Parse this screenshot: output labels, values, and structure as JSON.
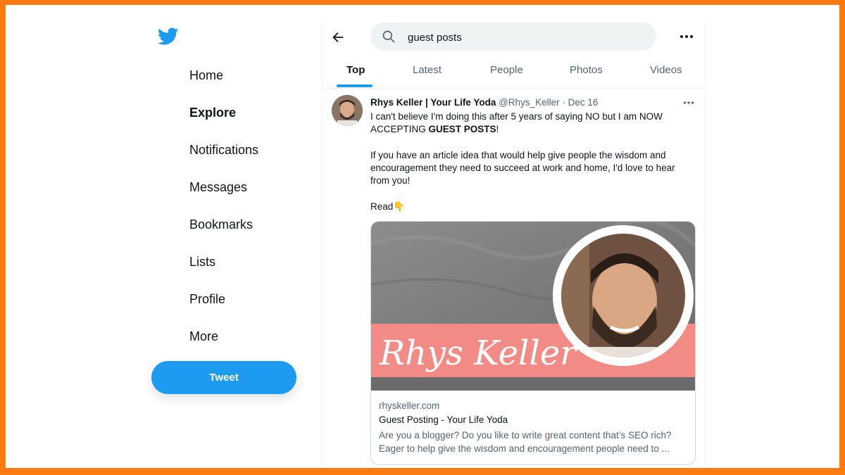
{
  "colors": {
    "border_frame": "#fc7b11",
    "accent": "#1d9bf0",
    "text_primary": "#0f1419",
    "text_secondary": "#536471",
    "card_banner": "#f28b86"
  },
  "sidebar": {
    "logo_icon": "twitter-bird-icon",
    "items": [
      {
        "label": "Home"
      },
      {
        "label": "Explore",
        "active": true
      },
      {
        "label": "Notifications"
      },
      {
        "label": "Messages"
      },
      {
        "label": "Bookmarks"
      },
      {
        "label": "Lists"
      },
      {
        "label": "Profile"
      },
      {
        "label": "More"
      }
    ],
    "tweet_button": "Tweet"
  },
  "header": {
    "search_value": "guest posts",
    "tabs": [
      {
        "label": "Top",
        "active": true
      },
      {
        "label": "Latest"
      },
      {
        "label": "People"
      },
      {
        "label": "Photos"
      },
      {
        "label": "Videos"
      }
    ]
  },
  "tweet": {
    "name": "Rhys Keller | Your Life Yoda",
    "handle": "@Rhys_Keller",
    "separator": " · ",
    "date": "Dec 16",
    "line1": "I can't believe I'm doing this after 5 years of saying NO but I am NOW ACCEPTING ",
    "line1_bold": "GUEST POSTS",
    "line1_end": "!",
    "paragraph2": "If you have an article idea that would help give people the wisdom and encouragement they need to succeed at work and home, I'd love to hear from you!",
    "read_label": "Read",
    "read_emoji": "👇",
    "card": {
      "image_signature": "Rhys Keller",
      "domain": "rhyskeller.com",
      "title": "Guest Posting - Your Life Yoda",
      "description": "Are you a blogger? Do you like to write great content that’s SEO rich? Eager to help give the wisdom and encouragement people need to ..."
    }
  }
}
